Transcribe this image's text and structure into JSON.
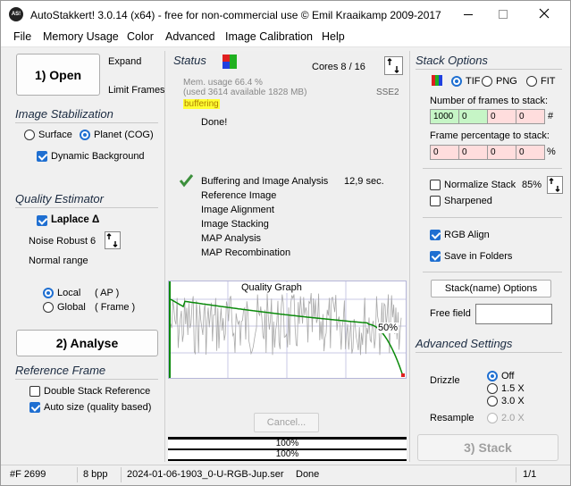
{
  "window": {
    "title": "AutoStakkert! 3.0.14 (x64) - free for non-commercial use © Emil Kraaikamp 2009-2017",
    "app_icon_text": "AS!"
  },
  "menu": [
    "File",
    "Memory Usage",
    "Color",
    "Advanced",
    "Image Calibration",
    "Help"
  ],
  "left": {
    "open_label": "1) Open",
    "expand_label": "Expand",
    "limit_frames_label": "Limit Frames",
    "stabilization_title": "Image Stabilization",
    "surface_label": "Surface",
    "planet_label": "Planet (COG)",
    "dynamic_bg_label": "Dynamic Background",
    "quality_title": "Quality Estimator",
    "laplace_label": "Laplace Δ",
    "noise_robust_label": "Noise Robust",
    "noise_robust_value": "6",
    "normal_range_label": "Normal range",
    "local_label": "Local",
    "local_ap": "( AP )",
    "global_label": "Global",
    "global_frame": "( Frame )",
    "analyse_label": "2) Analyse",
    "reference_title": "Reference Frame",
    "double_stack_label": "Double Stack Reference",
    "auto_size_label": "Auto size (quality based)"
  },
  "center": {
    "status_title": "Status",
    "cores": "Cores 8 / 16",
    "mem_usage": "Mem. usage 66.4 %",
    "mem_detail": "(used 3614 available 1828 MB)",
    "sse": "SSE2",
    "buffering_tag": "buffering",
    "done": "Done!",
    "steps": [
      {
        "label": "Buffering and Image Analysis",
        "time": "12,9 sec.",
        "done": true
      },
      {
        "label": "Reference Image",
        "time": "",
        "done": false
      },
      {
        "label": "Image Alignment",
        "time": "",
        "done": false
      },
      {
        "label": "Image Stacking",
        "time": "",
        "done": false
      },
      {
        "label": "MAP Analysis",
        "time": "",
        "done": false
      },
      {
        "label": "MAP Recombination",
        "time": "",
        "done": false
      }
    ],
    "graph_title": "Quality Graph",
    "graph_percent": "50%",
    "cancel_label": "Cancel...",
    "progress_1": "100%",
    "progress_2": "100%"
  },
  "right": {
    "stack_options_title": "Stack Options",
    "formats": [
      "TIF",
      "PNG",
      "FIT"
    ],
    "frames_label": "Number of frames to stack:",
    "frames_values": [
      "1000",
      "0",
      "0",
      "0"
    ],
    "frames_unit": "#",
    "percent_label": "Frame percentage to stack:",
    "percent_values": [
      "0",
      "0",
      "0",
      "0"
    ],
    "percent_unit": "%",
    "normalize_label": "Normalize Stack",
    "normalize_value": "85%",
    "sharpened_label": "Sharpened",
    "rgb_align_label": "RGB Align",
    "save_folders_label": "Save in Folders",
    "stack_name_options_label": "Stack(name) Options",
    "free_field_label": "Free field",
    "free_field_value": "",
    "advanced_title": "Advanced Settings",
    "drizzle_label": "Drizzle",
    "drizzle_options": [
      "Off",
      "1.5 X",
      "3.0 X"
    ],
    "resample_label": "Resample",
    "resample_option": "2.0 X",
    "stack_button_label": "3) Stack"
  },
  "statusbar": {
    "frames": "#F 2699",
    "bpp": "8 bpp",
    "file": "2024-01-06-1903_0-U-RGB-Jup.ser",
    "state": "Done",
    "page": "1/1"
  },
  "colors": {
    "accent_blue": "#1f6fd1",
    "cell_red": "#ffdddd",
    "cell_green": "#c6f5c6",
    "graph_curve": "#0a8a0a",
    "buffering_bg": "#ffff33"
  }
}
